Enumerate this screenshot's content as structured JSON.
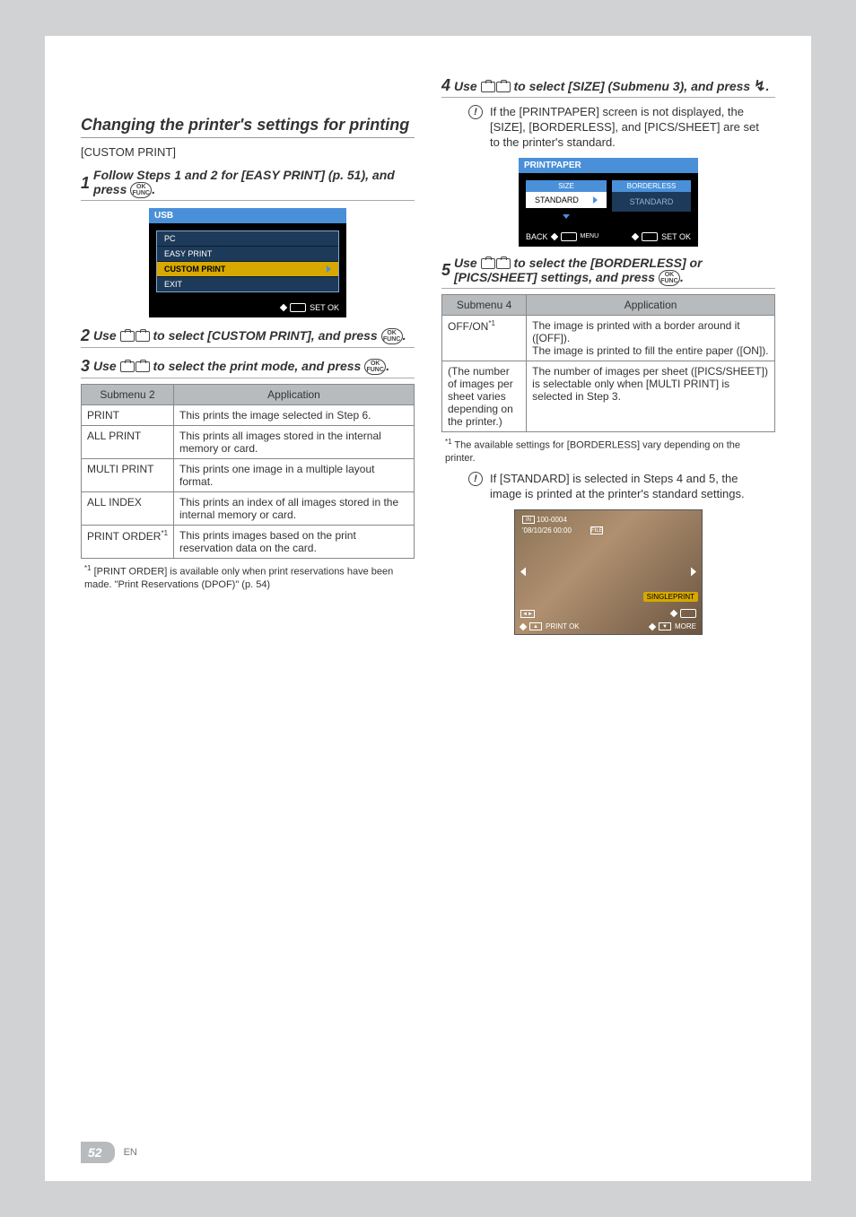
{
  "left": {
    "title": "Changing the printer's settings for printing",
    "subtitle": "[CUSTOM PRINT]",
    "step1": {
      "num": "1",
      "text1": "Follow Steps 1 and 2 for [EASY PRINT] (p. 51), and press ",
      "text2": "."
    },
    "lcd1": {
      "title": "USB",
      "items": [
        "PC",
        "EASY PRINT",
        "CUSTOM PRINT",
        "EXIT"
      ],
      "foot": "SET OK"
    },
    "step2": {
      "num": "2",
      "text1": "Use ",
      "text2": " to select [CUSTOM PRINT], and press ",
      "text3": "."
    },
    "step3": {
      "num": "3",
      "text1": "Use ",
      "text2": " to select the print mode, and press ",
      "text3": "."
    },
    "table": {
      "h1": "Submenu 2",
      "h2": "Application",
      "rows": [
        {
          "k": "PRINT",
          "v": "This prints the image selected in Step 6."
        },
        {
          "k": "ALL PRINT",
          "v": "This prints all images stored in the internal memory or card."
        },
        {
          "k": "MULTI PRINT",
          "v": "This prints one image in a multiple layout format."
        },
        {
          "k": "ALL INDEX",
          "v": "This prints an index of all images stored in the internal memory or card."
        },
        {
          "k": "PRINT ORDER",
          "sup": "*1",
          "v": "This prints images based on the print reservation data on the card."
        }
      ]
    },
    "footnote": "[PRINT ORDER] is available only when print reservations have been made. \"Print Reservations (DPOF)\" (p. 54)",
    "sup": "*1"
  },
  "right": {
    "step4": {
      "num": "4",
      "text1": "Use ",
      "text2": " to select [SIZE] (Submenu 3), and press ",
      "text3": "."
    },
    "note1": "If the [PRINTPAPER] screen is not displayed, the [SIZE], [BORDERLESS], and [PICS/SHEET] are set to the printer's standard.",
    "lcd2": {
      "title": "PRINTPAPER",
      "hdr1": "SIZE",
      "hdr2": "BORDERLESS",
      "val": "STANDARD",
      "back": "BACK",
      "footL": "MENU",
      "footR": "SET OK"
    },
    "step5": {
      "num": "5",
      "text1": "Use ",
      "text2": " to select the [BORDERLESS] or [PICS/SHEET] settings, and press ",
      "text3": "."
    },
    "table": {
      "h1": "Submenu 4",
      "h2": "Application",
      "rows": [
        {
          "k": "OFF/ON",
          "sup": "*1",
          "v": "The image is printed with a border around it ([OFF]).\nThe image is printed to fill the entire paper ([ON])."
        },
        {
          "k": "(The number of images per sheet varies depending on the printer.)",
          "v": "The number of images per sheet ([PICS/SHEET]) is selectable only when [MULTI PRINT] is selected in Step 3."
        }
      ]
    },
    "footnote": "The available settings for [BORDERLESS] vary depending on the printer.",
    "sup": "*1",
    "note2": "If [STANDARD] is selected in Steps 4 and 5, the image is printed at the printer's standard settings.",
    "photo": {
      "topleft_num": "100-0004",
      "in_badge": "IN",
      "date_badge": "'08/10/26 00:00",
      "file_badge": "FILE",
      "singleprint": "SINGLEPRINT",
      "print": "PRINT OK",
      "more": "MORE"
    }
  },
  "footer": {
    "pagenum": "52",
    "text": "EN"
  }
}
